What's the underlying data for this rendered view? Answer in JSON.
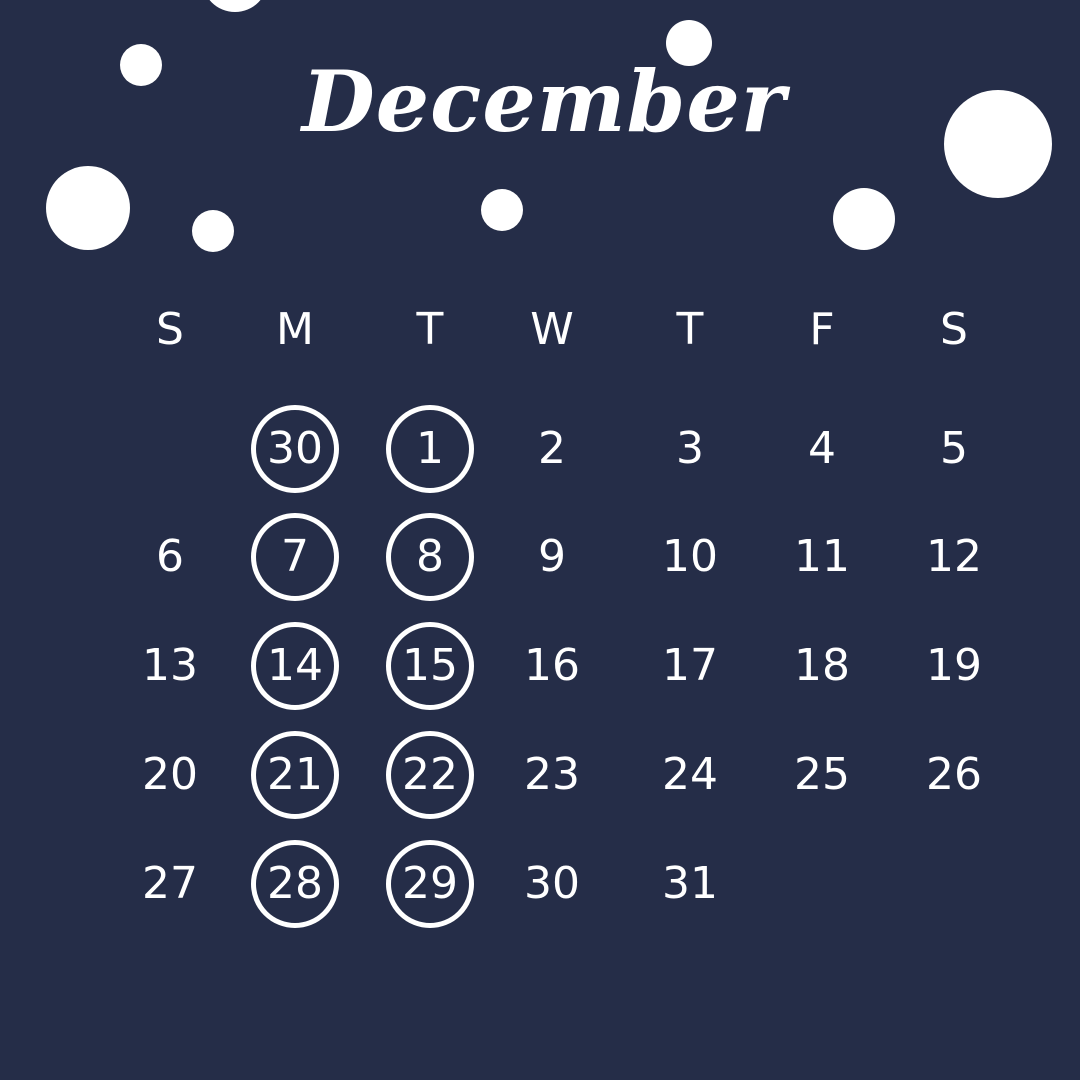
{
  "title": "December",
  "weekdays": [
    "S",
    "M",
    "T",
    "W",
    "T",
    "F",
    "S"
  ],
  "weeks": [
    [
      "",
      "30",
      "1",
      "2",
      "3",
      "4",
      "5"
    ],
    [
      "6",
      "7",
      "8",
      "9",
      "10",
      "11",
      "12"
    ],
    [
      "13",
      "14",
      "15",
      "16",
      "17",
      "18",
      "19"
    ],
    [
      "20",
      "21",
      "22",
      "23",
      "24",
      "25",
      "26"
    ],
    [
      "27",
      "28",
      "29",
      "30",
      "31",
      "",
      ""
    ]
  ],
  "circled_columns": [
    1,
    2
  ]
}
